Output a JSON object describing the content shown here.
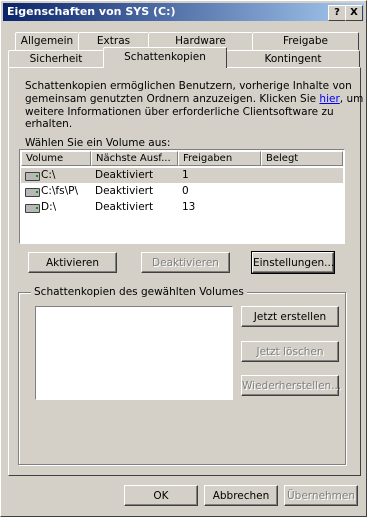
{
  "window": {
    "title": "Eigenschaften von SYS (C:)",
    "help_btn": "?",
    "close_btn": "X"
  },
  "tabs_row1": [
    "Allgemein",
    "Extras",
    "Hardware",
    "Freigabe"
  ],
  "tabs_row2": [
    "Sicherheit",
    "Schattenkopien",
    "Kontingent"
  ],
  "active_tab": "Schattenkopien",
  "description": {
    "line1": "Schattenkopien ermöglichen Benutzern, vorherige Inhalte von",
    "line2a": "gemeinsam genutzten Ordnern anzuzeigen. Klicken Sie ",
    "link": "hier",
    "line2b": ", um",
    "line3": "weitere Informationen über erforderliche Clientsoftware zu erhalten."
  },
  "volume_label": "Wählen Sie ein Volume aus:",
  "table": {
    "headers": [
      "Volume",
      "Nächste Ausf...",
      "Freigaben",
      "Belegt"
    ],
    "rows": [
      {
        "volume": "C:\\",
        "next": "Deaktiviert",
        "shares": "1",
        "used": ""
      },
      {
        "volume": "C:\\fs\\P\\",
        "next": "Deaktiviert",
        "shares": "0",
        "used": ""
      },
      {
        "volume": "D:\\",
        "next": "Deaktiviert",
        "shares": "13",
        "used": ""
      }
    ]
  },
  "buttons": {
    "activate": "Aktivieren",
    "deactivate": "Deaktivieren",
    "settings": "Einstellungen...",
    "create_now": "Jetzt erstellen",
    "delete_now": "Jetzt löschen",
    "restore": "Wiederherstellen...",
    "ok": "OK",
    "cancel": "Abbrechen",
    "apply": "Übernehmen"
  },
  "group_title": "Schattenkopien des gewählten Volumes"
}
